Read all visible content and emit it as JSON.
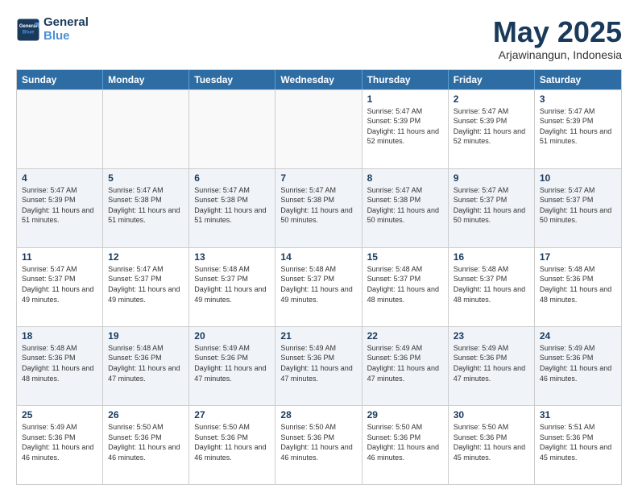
{
  "logo": {
    "line1": "General",
    "line2": "Blue"
  },
  "title": "May 2025",
  "location": "Arjawinangun, Indonesia",
  "days": [
    "Sunday",
    "Monday",
    "Tuesday",
    "Wednesday",
    "Thursday",
    "Friday",
    "Saturday"
  ],
  "rows": [
    [
      {
        "day": "",
        "empty": true
      },
      {
        "day": "",
        "empty": true
      },
      {
        "day": "",
        "empty": true
      },
      {
        "day": "",
        "empty": true
      },
      {
        "day": "1",
        "sunrise": "5:47 AM",
        "sunset": "5:39 PM",
        "daylight": "11 hours and 52 minutes."
      },
      {
        "day": "2",
        "sunrise": "5:47 AM",
        "sunset": "5:39 PM",
        "daylight": "11 hours and 52 minutes."
      },
      {
        "day": "3",
        "sunrise": "5:47 AM",
        "sunset": "5:39 PM",
        "daylight": "11 hours and 51 minutes."
      }
    ],
    [
      {
        "day": "4",
        "sunrise": "5:47 AM",
        "sunset": "5:39 PM",
        "daylight": "11 hours and 51 minutes."
      },
      {
        "day": "5",
        "sunrise": "5:47 AM",
        "sunset": "5:38 PM",
        "daylight": "11 hours and 51 minutes."
      },
      {
        "day": "6",
        "sunrise": "5:47 AM",
        "sunset": "5:38 PM",
        "daylight": "11 hours and 51 minutes."
      },
      {
        "day": "7",
        "sunrise": "5:47 AM",
        "sunset": "5:38 PM",
        "daylight": "11 hours and 50 minutes."
      },
      {
        "day": "8",
        "sunrise": "5:47 AM",
        "sunset": "5:38 PM",
        "daylight": "11 hours and 50 minutes."
      },
      {
        "day": "9",
        "sunrise": "5:47 AM",
        "sunset": "5:37 PM",
        "daylight": "11 hours and 50 minutes."
      },
      {
        "day": "10",
        "sunrise": "5:47 AM",
        "sunset": "5:37 PM",
        "daylight": "11 hours and 50 minutes."
      }
    ],
    [
      {
        "day": "11",
        "sunrise": "5:47 AM",
        "sunset": "5:37 PM",
        "daylight": "11 hours and 49 minutes."
      },
      {
        "day": "12",
        "sunrise": "5:47 AM",
        "sunset": "5:37 PM",
        "daylight": "11 hours and 49 minutes."
      },
      {
        "day": "13",
        "sunrise": "5:48 AM",
        "sunset": "5:37 PM",
        "daylight": "11 hours and 49 minutes."
      },
      {
        "day": "14",
        "sunrise": "5:48 AM",
        "sunset": "5:37 PM",
        "daylight": "11 hours and 49 minutes."
      },
      {
        "day": "15",
        "sunrise": "5:48 AM",
        "sunset": "5:37 PM",
        "daylight": "11 hours and 48 minutes."
      },
      {
        "day": "16",
        "sunrise": "5:48 AM",
        "sunset": "5:37 PM",
        "daylight": "11 hours and 48 minutes."
      },
      {
        "day": "17",
        "sunrise": "5:48 AM",
        "sunset": "5:36 PM",
        "daylight": "11 hours and 48 minutes."
      }
    ],
    [
      {
        "day": "18",
        "sunrise": "5:48 AM",
        "sunset": "5:36 PM",
        "daylight": "11 hours and 48 minutes."
      },
      {
        "day": "19",
        "sunrise": "5:48 AM",
        "sunset": "5:36 PM",
        "daylight": "11 hours and 47 minutes."
      },
      {
        "day": "20",
        "sunrise": "5:49 AM",
        "sunset": "5:36 PM",
        "daylight": "11 hours and 47 minutes."
      },
      {
        "day": "21",
        "sunrise": "5:49 AM",
        "sunset": "5:36 PM",
        "daylight": "11 hours and 47 minutes."
      },
      {
        "day": "22",
        "sunrise": "5:49 AM",
        "sunset": "5:36 PM",
        "daylight": "11 hours and 47 minutes."
      },
      {
        "day": "23",
        "sunrise": "5:49 AM",
        "sunset": "5:36 PM",
        "daylight": "11 hours and 47 minutes."
      },
      {
        "day": "24",
        "sunrise": "5:49 AM",
        "sunset": "5:36 PM",
        "daylight": "11 hours and 46 minutes."
      }
    ],
    [
      {
        "day": "25",
        "sunrise": "5:49 AM",
        "sunset": "5:36 PM",
        "daylight": "11 hours and 46 minutes."
      },
      {
        "day": "26",
        "sunrise": "5:50 AM",
        "sunset": "5:36 PM",
        "daylight": "11 hours and 46 minutes."
      },
      {
        "day": "27",
        "sunrise": "5:50 AM",
        "sunset": "5:36 PM",
        "daylight": "11 hours and 46 minutes."
      },
      {
        "day": "28",
        "sunrise": "5:50 AM",
        "sunset": "5:36 PM",
        "daylight": "11 hours and 46 minutes."
      },
      {
        "day": "29",
        "sunrise": "5:50 AM",
        "sunset": "5:36 PM",
        "daylight": "11 hours and 46 minutes."
      },
      {
        "day": "30",
        "sunrise": "5:50 AM",
        "sunset": "5:36 PM",
        "daylight": "11 hours and 45 minutes."
      },
      {
        "day": "31",
        "sunrise": "5:51 AM",
        "sunset": "5:36 PM",
        "daylight": "11 hours and 45 minutes."
      }
    ]
  ]
}
